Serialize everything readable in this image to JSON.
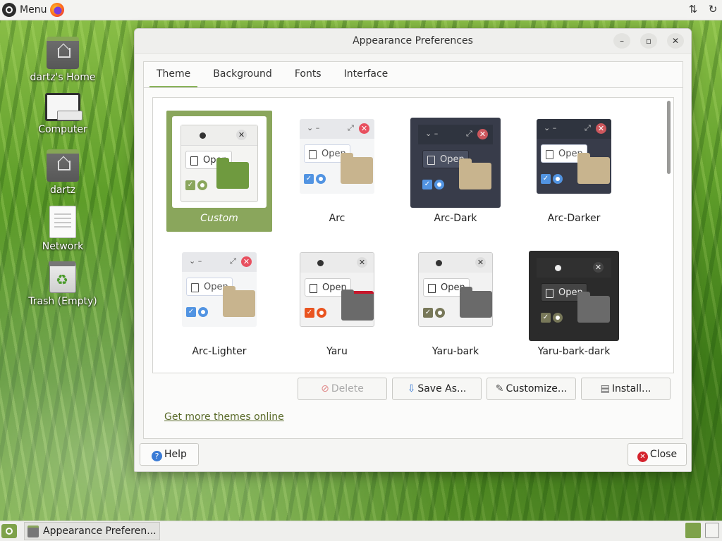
{
  "top_panel": {
    "menu_label": "Menu"
  },
  "desktop": {
    "icons": [
      {
        "label": "dartz's Home"
      },
      {
        "label": "Computer"
      },
      {
        "label": "dartz"
      },
      {
        "label": "Network"
      },
      {
        "label": "Trash (Empty)"
      }
    ]
  },
  "window": {
    "title": "Appearance Preferences",
    "tabs": [
      {
        "label": "Theme"
      },
      {
        "label": "Background"
      },
      {
        "label": "Fonts"
      },
      {
        "label": "Interface"
      }
    ],
    "preview_open_label": "Open",
    "themes": [
      {
        "name": "Custom",
        "selected": true
      },
      {
        "name": "Arc"
      },
      {
        "name": "Arc-Dark"
      },
      {
        "name": "Arc-Darker"
      },
      {
        "name": "Arc-Lighter"
      },
      {
        "name": "Yaru"
      },
      {
        "name": "Yaru-bark"
      },
      {
        "name": "Yaru-bark-dark"
      }
    ],
    "actions": {
      "delete": "Delete",
      "save_as": "Save As...",
      "customize": "Customize...",
      "install": "Install..."
    },
    "more_themes_link": "Get more themes online",
    "help": "Help",
    "close": "Close"
  },
  "taskbar": {
    "task_label": "Appearance Preferen..."
  },
  "colors": {
    "accent": "#8aa65c",
    "close_red": "#d4232d",
    "help_blue": "#3a7bd5"
  }
}
